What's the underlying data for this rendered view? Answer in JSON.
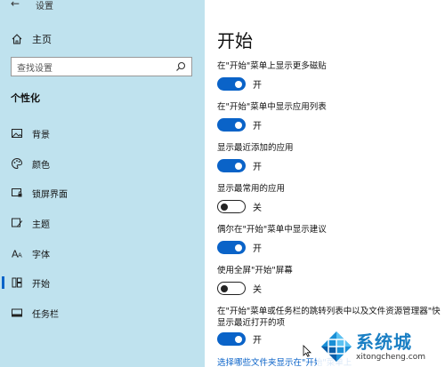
{
  "window": {
    "title": "设置"
  },
  "sidebar": {
    "home_label": "主页",
    "search_placeholder": "查找设置",
    "section_title": "个性化",
    "items": [
      {
        "label": "背景",
        "icon": "picture-icon",
        "active": false
      },
      {
        "label": "颜色",
        "icon": "palette-icon",
        "active": false
      },
      {
        "label": "锁屏界面",
        "icon": "lock-screen-icon",
        "active": false
      },
      {
        "label": "主题",
        "icon": "brush-icon",
        "active": false
      },
      {
        "label": "字体",
        "icon": "font-icon",
        "active": false
      },
      {
        "label": "开始",
        "icon": "start-icon",
        "active": true
      },
      {
        "label": "任务栏",
        "icon": "taskbar-icon",
        "active": false
      }
    ]
  },
  "main": {
    "title": "开始",
    "settings": [
      {
        "label": "在\"开始\"菜单上显示更多磁贴",
        "state": "开",
        "on": true
      },
      {
        "label": "在\"开始\"菜单中显示应用列表",
        "state": "开",
        "on": true
      },
      {
        "label": "显示最近添加的应用",
        "state": "开",
        "on": true
      },
      {
        "label": "显示最常用的应用",
        "state": "关",
        "on": false
      },
      {
        "label": "偶尔在\"开始\"菜单中显示建议",
        "state": "开",
        "on": true
      },
      {
        "label": "使用全屏\"开始\"屏幕",
        "state": "关",
        "on": false
      },
      {
        "label": "在\"开始\"菜单或任务栏的跳转列表中以及文件资源管理器\"快",
        "label2": "显示最近打开的项",
        "state": "开",
        "on": true
      }
    ],
    "link": "选择哪些文件夹显示在\"开始\"菜单上"
  },
  "watermark": {
    "big": "系统城",
    "small": "xitongcheng.com"
  },
  "colors": {
    "accent": "#0a63c8",
    "sidebar_bg": "#bfe2ee"
  }
}
